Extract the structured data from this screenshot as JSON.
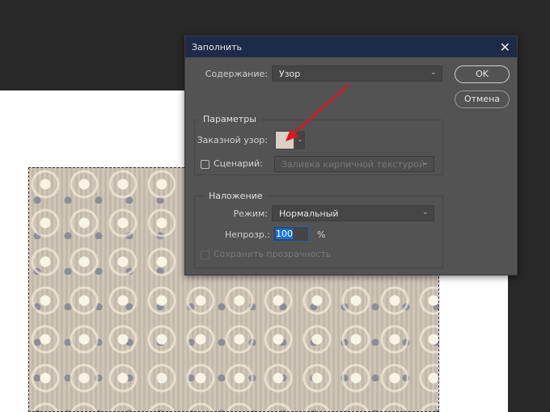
{
  "dialog": {
    "title": "Заполнить",
    "content_label": "Содержание:",
    "content_value": "Узор",
    "ok": "OK",
    "cancel": "Отмена",
    "params": {
      "title": "Параметры",
      "custom_pattern_label": "Заказной узор:",
      "script_label": "Сценарий:",
      "script_value": "Заливка кирпичной текстурой",
      "script_checked": false
    },
    "blend": {
      "title": "Наложение",
      "mode_label": "Режим:",
      "mode_value": "Нормальный",
      "opacity_label": "Непрозр.:",
      "opacity_value": "100",
      "opacity_unit": "%",
      "preserve_label": "Сохранить прозрачность",
      "preserve_checked": false
    }
  },
  "colors": {
    "arrow": "#e0141c",
    "titlebar": "#1e2b48",
    "accent": "#1473e6"
  }
}
